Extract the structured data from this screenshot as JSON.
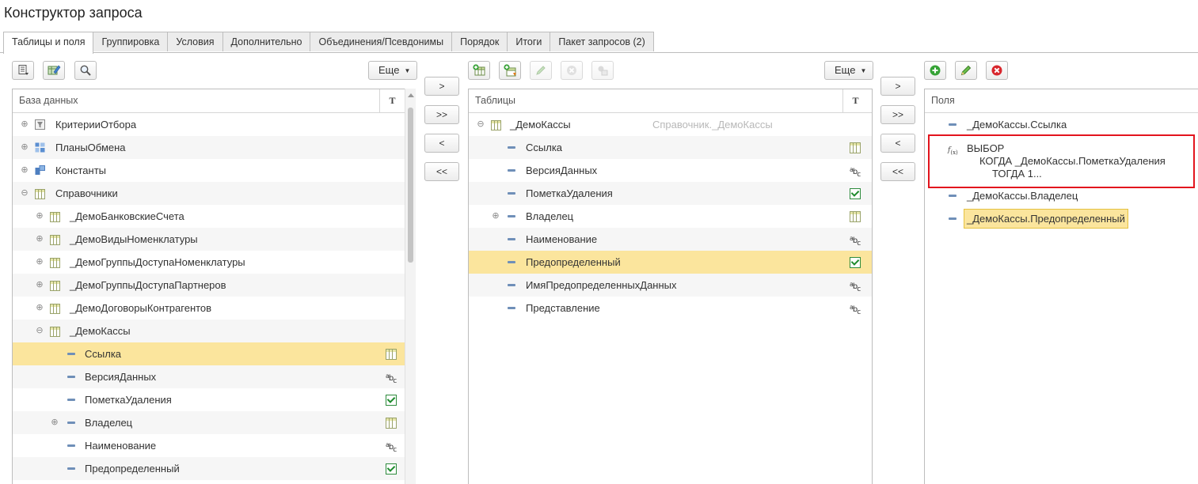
{
  "window": {
    "title": "Конструктор запроса"
  },
  "tabs": [
    {
      "label": "Таблицы и поля",
      "active": true
    },
    {
      "label": "Группировка"
    },
    {
      "label": "Условия"
    },
    {
      "label": "Дополнительно"
    },
    {
      "label": "Объединения/Псевдонимы"
    },
    {
      "label": "Порядок"
    },
    {
      "label": "Итоги"
    },
    {
      "label": "Пакет запросов (2)"
    }
  ],
  "left_toolbar": {
    "more_label": "Еще"
  },
  "middle_toolbar": {
    "more_label": "Еще"
  },
  "move_buttons": {
    "add": ">",
    "add_all": ">>",
    "remove": "<",
    "remove_all": "<<"
  },
  "database_panel": {
    "header": "База данных",
    "type_header": "Т",
    "rows": [
      {
        "label": "КритерииОтбора",
        "icon": "filter-criteria-icon"
      },
      {
        "label": "ПланыОбмена",
        "icon": "exchange-plan-icon"
      },
      {
        "label": "Константы",
        "icon": "constants-icon"
      },
      {
        "label": "Справочники",
        "icon": "table-icon"
      },
      {
        "label": "_ДемоБанковскиеСчета",
        "icon": "table-icon"
      },
      {
        "label": "_ДемоВидыНоменклатуры",
        "icon": "table-icon"
      },
      {
        "label": "_ДемоГруппыДоступаНоменклатуры",
        "icon": "table-icon"
      },
      {
        "label": "_ДемоГруппыДоступаПартнеров",
        "icon": "table-icon"
      },
      {
        "label": "_ДемоДоговорыКонтрагентов",
        "icon": "table-icon"
      },
      {
        "label": "_ДемоКассы",
        "icon": "table-icon"
      },
      {
        "label": "Ссылка",
        "type": "table-type-icon",
        "selected": true
      },
      {
        "label": "ВерсияДанных",
        "type": "abc-type-icon"
      },
      {
        "label": "ПометкаУдаления",
        "type": "boolean-type-icon"
      },
      {
        "label": "Владелец",
        "type": "table-type-icon"
      },
      {
        "label": "Наименование",
        "type": "abc-type-icon"
      },
      {
        "label": "Предопределенный",
        "type": "boolean-type-icon"
      }
    ]
  },
  "tables_panel": {
    "header": "Таблицы",
    "type_header": "Т",
    "root": {
      "label": "_ДемоКассы",
      "alias_hint": "Справочник._ДемоКассы"
    },
    "rows": [
      {
        "label": "Ссылка",
        "type": "table-type-icon"
      },
      {
        "label": "ВерсияДанных",
        "type": "abc-type-icon"
      },
      {
        "label": "ПометкаУдаления",
        "type": "boolean-type-icon"
      },
      {
        "label": "Владелец",
        "type": "table-type-icon"
      },
      {
        "label": "Наименование",
        "type": "abc-type-icon"
      },
      {
        "label": "Предопределенный",
        "type": "boolean-type-icon",
        "selected": true
      },
      {
        "label": "ИмяПредопределенныхДанных",
        "type": "abc-type-icon"
      },
      {
        "label": "Представление",
        "type": "abc-type-icon"
      }
    ]
  },
  "fields_panel": {
    "header": "Поля",
    "rows": [
      {
        "label": "_ДемоКассы.Ссылка"
      },
      {
        "line1": "ВЫБОР",
        "line2": "КОГДА _ДемоКассы.ПометкаУдаления",
        "line3": "ТОГДА 1..."
      },
      {
        "label": "_ДемоКассы.Владелец"
      },
      {
        "label": "_ДемоКассы.Предопределенный",
        "selected": true
      }
    ]
  },
  "colors": {
    "accent_selection": "#fbe59d",
    "highlight_box": "#e3141d"
  }
}
